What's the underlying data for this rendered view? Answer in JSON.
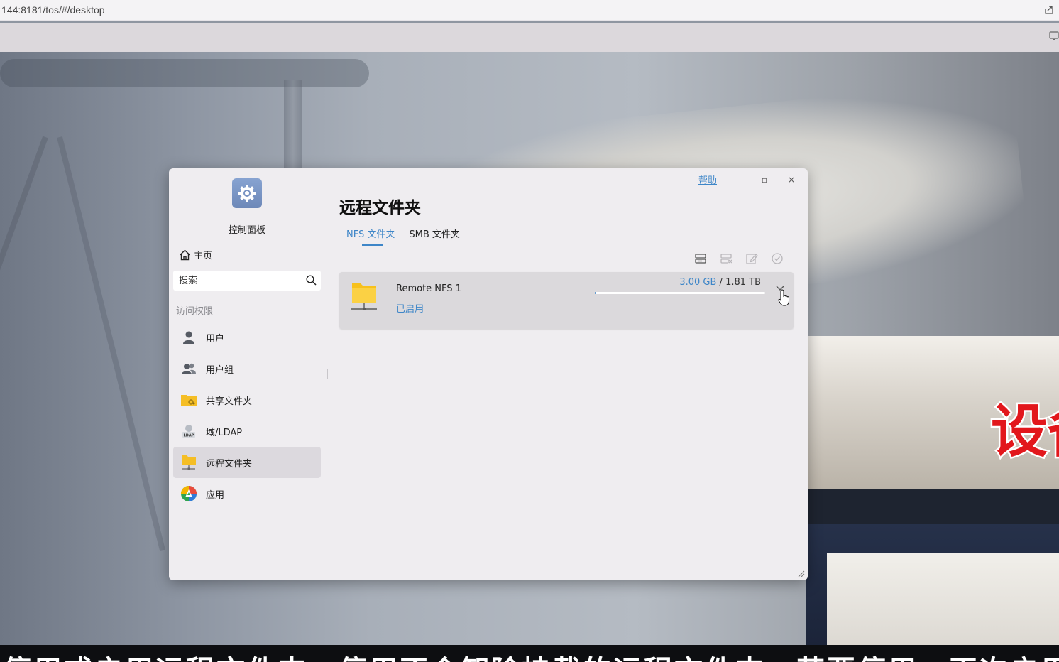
{
  "browser": {
    "url": "144:8181/tos/#/desktop"
  },
  "wallpaper": {
    "overlay_text": "设备",
    "subtitle": "停用或启用远程文件夹，停用不会卸除挂载的远程文件夹，若要停用，再次启用"
  },
  "window": {
    "help_label": "帮助",
    "minimize_label": "–",
    "maximize_label": "▫",
    "close_label": "×"
  },
  "sidebar": {
    "app_title": "控制面板",
    "home_label": "主页",
    "search_placeholder": "搜索",
    "section_label": "访问权限",
    "items": [
      {
        "label": "用户",
        "icon": "user-icon"
      },
      {
        "label": "用户组",
        "icon": "user-group-icon"
      },
      {
        "label": "共享文件夹",
        "icon": "shared-folder-icon"
      },
      {
        "label": "域/LDAP",
        "icon": "ldap-icon"
      },
      {
        "label": "远程文件夹",
        "icon": "remote-folder-icon",
        "active": true
      },
      {
        "label": "应用",
        "icon": "apps-icon"
      }
    ]
  },
  "main": {
    "title": "远程文件夹",
    "tabs": [
      {
        "label": "NFS 文件夹",
        "active": true
      },
      {
        "label": "SMB 文件夹",
        "active": false
      }
    ],
    "toolbar": [
      "add-mount-icon",
      "remove-icon",
      "edit-icon",
      "enable-check-icon"
    ],
    "folders": [
      {
        "name": "Remote NFS 1",
        "status": "已启用",
        "used": "3.00 GB",
        "separator": " / ",
        "total": "1.81 TB",
        "usage_fraction": 0.0016
      }
    ]
  },
  "colors": {
    "accent": "#3e86c8",
    "window_bg": "#efedf0",
    "active_item_bg": "#dcd9de",
    "overlay_red": "#e2171c"
  }
}
